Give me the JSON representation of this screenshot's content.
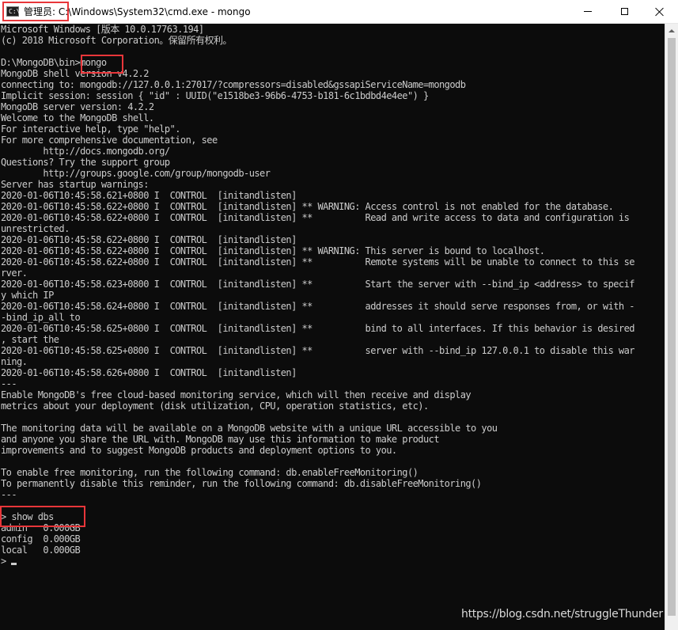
{
  "window": {
    "title_prefix": "管理员: ",
    "title_rest": "C:\\Windows\\System32\\cmd.exe - mongo",
    "app_icon_glyph": "C:\\",
    "controls": {
      "minimize_icon": "minimize-icon",
      "maximize_icon": "maximize-icon",
      "close_icon": "close-icon"
    }
  },
  "console": {
    "foreground": "#cccccc",
    "background": "#0c0c0c",
    "lines": [
      "Microsoft Windows [版本 10.0.17763.194]",
      "(c) 2018 Microsoft Corporation。保留所有权利。",
      "",
      "D:\\MongoDB\\bin>mongo",
      "MongoDB shell version v4.2.2",
      "connecting to: mongodb://127.0.0.1:27017/?compressors=disabled&gssapiServiceName=mongodb",
      "Implicit session: session { \"id\" : UUID(\"e1518be3-96b6-4753-b181-6c1bdbd4e4ee\") }",
      "MongoDB server version: 4.2.2",
      "Welcome to the MongoDB shell.",
      "For interactive help, type \"help\".",
      "For more comprehensive documentation, see",
      "        http://docs.mongodb.org/",
      "Questions? Try the support group",
      "        http://groups.google.com/group/mongodb-user",
      "Server has startup warnings:",
      "2020-01-06T10:45:58.621+0800 I  CONTROL  [initandlisten]",
      "2020-01-06T10:45:58.622+0800 I  CONTROL  [initandlisten] ** WARNING: Access control is not enabled for the database.",
      "2020-01-06T10:45:58.622+0800 I  CONTROL  [initandlisten] **          Read and write access to data and configuration is",
      "unrestricted.",
      "2020-01-06T10:45:58.622+0800 I  CONTROL  [initandlisten]",
      "2020-01-06T10:45:58.622+0800 I  CONTROL  [initandlisten] ** WARNING: This server is bound to localhost.",
      "2020-01-06T10:45:58.622+0800 I  CONTROL  [initandlisten] **          Remote systems will be unable to connect to this se",
      "rver.",
      "2020-01-06T10:45:58.623+0800 I  CONTROL  [initandlisten] **          Start the server with --bind_ip <address> to specif",
      "y which IP",
      "2020-01-06T10:45:58.624+0800 I  CONTROL  [initandlisten] **          addresses it should serve responses from, or with -",
      "-bind_ip_all to",
      "2020-01-06T10:45:58.625+0800 I  CONTROL  [initandlisten] **          bind to all interfaces. If this behavior is desired",
      ", start the",
      "2020-01-06T10:45:58.625+0800 I  CONTROL  [initandlisten] **          server with --bind_ip 127.0.0.1 to disable this war",
      "ning.",
      "2020-01-06T10:45:58.626+0800 I  CONTROL  [initandlisten]",
      "---",
      "Enable MongoDB's free cloud-based monitoring service, which will then receive and display",
      "metrics about your deployment (disk utilization, CPU, operation statistics, etc).",
      "",
      "The monitoring data will be available on a MongoDB website with a unique URL accessible to you",
      "and anyone you share the URL with. MongoDB may use this information to make product",
      "improvements and to suggest MongoDB products and deployment options to you.",
      "",
      "To enable free monitoring, run the following command: db.enableFreeMonitoring()",
      "To permanently disable this reminder, run the following command: db.disableFreeMonitoring()",
      "---",
      "",
      "> show dbs",
      "admin   0.000GB",
      "config  0.000GB",
      "local   0.000GB",
      ">"
    ]
  },
  "watermark": "https://blog.csdn.net/struggleThunder"
}
